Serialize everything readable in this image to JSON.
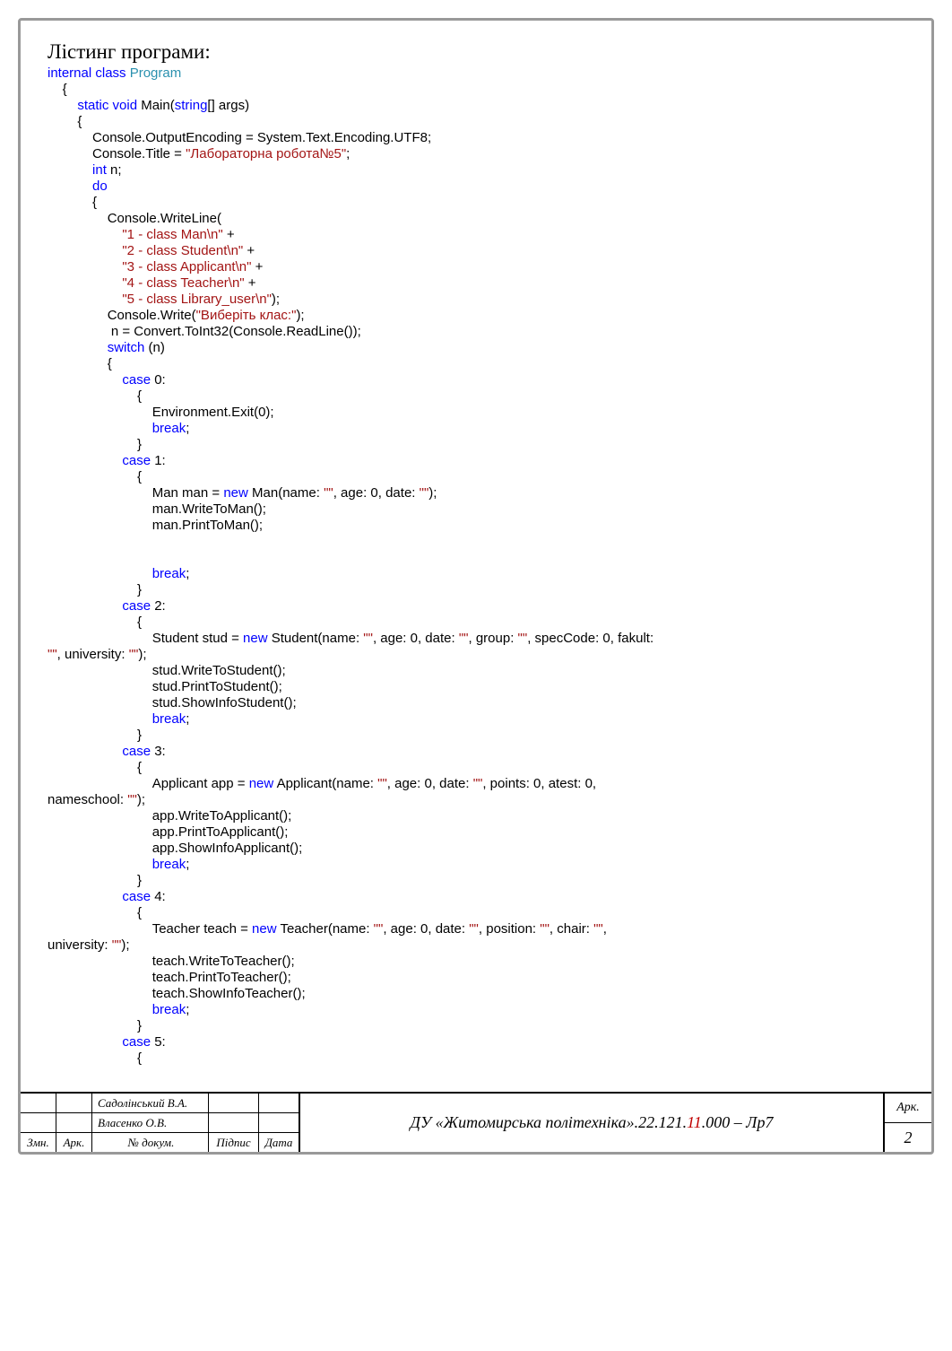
{
  "heading": "Лістинг програми:",
  "code": {
    "l01_kw1": "internal class ",
    "l01_cls": "Program",
    "l02": "    {",
    "l03_kw": "        static void ",
    "l03_txt1": "Main(",
    "l03_kw2": "string",
    "l03_txt2": "[] args)",
    "l04": "        {",
    "l05": "            Console.OutputEncoding = System.Text.Encoding.UTF8;",
    "l06_txt1": "            Console.Title = ",
    "l06_str": "\"Лабораторна робота№5\"",
    "l06_txt2": ";",
    "l07_kw": "            int ",
    "l07_txt": "n;",
    "l08_kw": "            do",
    "l09": "            {",
    "l10": "                Console.WriteLine(",
    "l11_str": "                    \"1 - class Man\\n\"",
    "l11_txt": " +",
    "l12_str": "                    \"2 - class Student\\n\"",
    "l12_txt": " +",
    "l13_str": "                    \"3 - class Applicant\\n\"",
    "l13_txt": " +",
    "l14_str": "                    \"4 - class Teacher\\n\"",
    "l14_txt": " +",
    "l15_str": "                    \"5 - class Library_user\\n\"",
    "l15_txt": ");",
    "l16_txt1": "                Console.Write(",
    "l16_str": "\"Виберіть клас:\"",
    "l16_txt2": ");",
    "l17": "                 n = Convert.ToInt32(Console.ReadLine());",
    "l18_kw": "                switch ",
    "l18_txt": "(n)",
    "l19": "                {",
    "l20_kw": "                    case ",
    "l20_txt": "0:",
    "l21": "                        {",
    "l22": "                            Environment.Exit(0);",
    "l23_kw": "                            break",
    "l23_txt": ";",
    "l24": "                        }",
    "l25_kw": "                    case ",
    "l25_txt": "1:",
    "l26": "                        {",
    "l27_txt1": "                            Man man = ",
    "l27_kw": "new ",
    "l27_txt2": "Man(name: ",
    "l27_str1": "\"\"",
    "l27_txt3": ", age: 0, date: ",
    "l27_str2": "\"\"",
    "l27_txt4": ");",
    "l28": "                            man.WriteToMan();",
    "l29": "                            man.PrintToMan();",
    "lblank1": "",
    "lblank2": "",
    "l30_kw": "                            break",
    "l30_txt": ";",
    "l31": "                        }",
    "l32_kw": "                    case ",
    "l32_txt": "2:",
    "l33": "                        {",
    "l34_txt1": "                            Student stud = ",
    "l34_kw": "new ",
    "l34_txt2": "Student(name: ",
    "l34_str1": "\"\"",
    "l34_txt3": ", age: 0, date: ",
    "l34_str2": "\"\"",
    "l34_txt4": ", group: ",
    "l34_str3": "\"\"",
    "l34_txt5": ", specCode: 0, fakult: ",
    "l34b_str": "\"\"",
    "l34b_txt1": ", university: ",
    "l34b_str2": "\"\"",
    "l34b_txt2": ");",
    "l35": "                            stud.WriteToStudent();",
    "l36": "                            stud.PrintToStudent();",
    "l37": "                            stud.ShowInfoStudent();",
    "l38_kw": "                            break",
    "l38_txt": ";",
    "l39": "                        }",
    "l40_kw": "                    case ",
    "l40_txt": "3:",
    "l41": "                        {",
    "l42_txt1": "                            Applicant app = ",
    "l42_kw": "new ",
    "l42_txt2": "Applicant(name: ",
    "l42_str1": "\"\"",
    "l42_txt3": ", age: 0, date: ",
    "l42_str2": "\"\"",
    "l42_txt4": ", points: 0, atest: 0,",
    "l42b_txt1": "nameschool: ",
    "l42b_str": "\"\"",
    "l42b_txt2": ");",
    "l43": "                            app.WriteToApplicant();",
    "l44": "                            app.PrintToApplicant();",
    "l45": "                            app.ShowInfoApplicant();",
    "l46_kw": "                            break",
    "l46_txt": ";",
    "l47": "                        }",
    "l48_kw": "                    case ",
    "l48_txt": "4:",
    "l49": "                        {",
    "l50_txt1": "                            Teacher teach = ",
    "l50_kw": "new ",
    "l50_txt2": "Teacher(name: ",
    "l50_str1": "\"\"",
    "l50_txt3": ", age: 0, date: ",
    "l50_str2": "\"\"",
    "l50_txt4": ", position: ",
    "l50_str3": "\"\"",
    "l50_txt5": ", chair: ",
    "l50_str4": "\"\"",
    "l50_txt6": ",",
    "l50b_txt1": "university: ",
    "l50b_str": "\"\"",
    "l50b_txt2": ");",
    "l51": "                            teach.WriteToTeacher();",
    "l52": "                            teach.PrintToTeacher();",
    "l53": "                            teach.ShowInfoTeacher();",
    "l54_kw": "                            break",
    "l54_txt": ";",
    "l55": "                        }",
    "l56_kw": "                    case ",
    "l56_txt": "5:",
    "l57": "                        {"
  },
  "title_block": {
    "row1_name": "Садолінський В.А.",
    "row2_name": "Власенко О.В.",
    "col_zmn": "Змн.",
    "col_ark": "Арк.",
    "col_docnum": "№ докум.",
    "col_pidpys": "Підпис",
    "col_data": "Дата",
    "center_pre": "ДУ «Житомирська політехніка».22.121.",
    "center_hl": "11",
    "center_post": ".000 – Лр7",
    "ark_label": "Арк.",
    "page_num": "2"
  }
}
